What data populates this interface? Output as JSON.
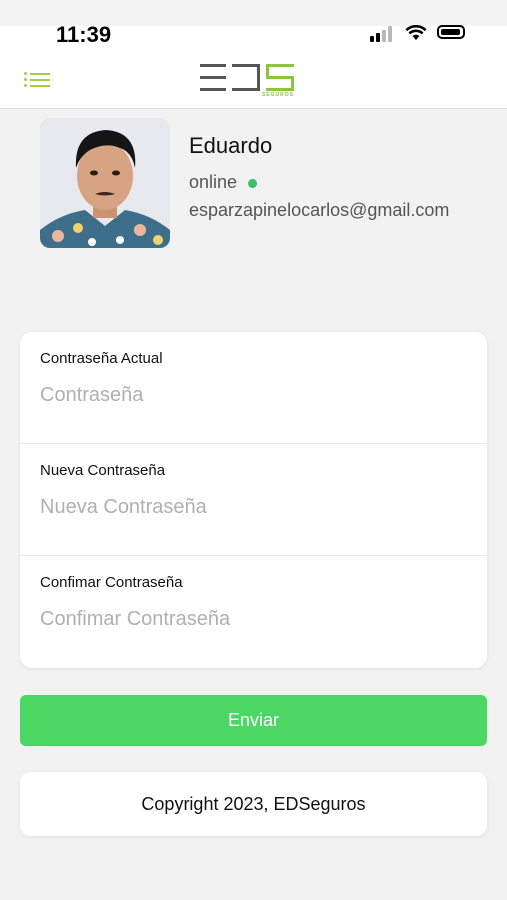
{
  "status_bar": {
    "time": "11:39"
  },
  "nav": {
    "logo_letters": "EDS",
    "logo_subtitle": "SEGUROS",
    "accent_color": "#9fd240"
  },
  "profile": {
    "name": "Eduardo",
    "status": "online",
    "status_color": "#3bbf6a",
    "email": "esparzapinelocarlos@gmail.com"
  },
  "form": {
    "fields": [
      {
        "label": "Contraseña Actual",
        "placeholder": "Contraseña",
        "value": ""
      },
      {
        "label": "Nueva Contraseña",
        "placeholder": "Nueva Contraseña",
        "value": ""
      },
      {
        "label": "Confimar Contraseña",
        "placeholder": "Confimar Contraseña",
        "value": ""
      }
    ],
    "submit_label": "Enviar",
    "submit_color": "#4cd765"
  },
  "footer": {
    "text": "Copyright 2023, EDSeguros"
  }
}
